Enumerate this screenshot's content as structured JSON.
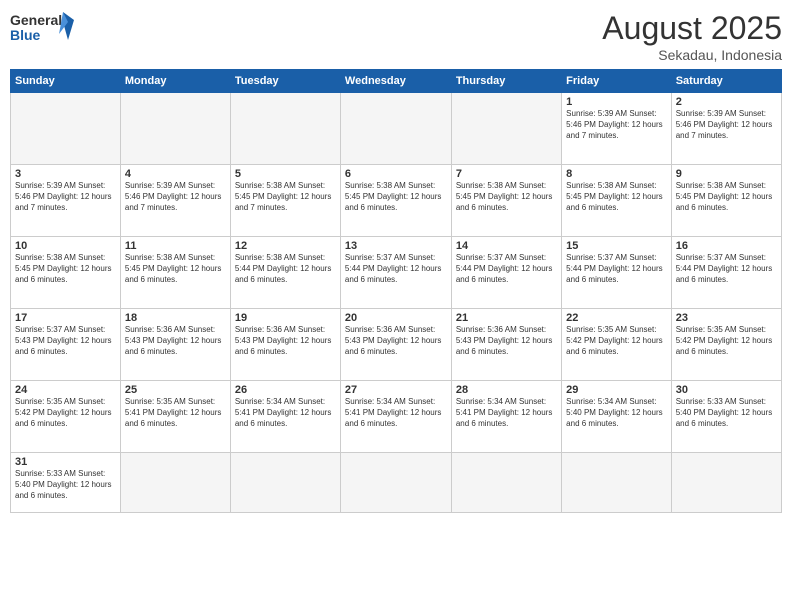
{
  "header": {
    "logo_general": "General",
    "logo_blue": "Blue",
    "month_year": "August 2025",
    "location": "Sekadau, Indonesia"
  },
  "weekdays": [
    "Sunday",
    "Monday",
    "Tuesday",
    "Wednesday",
    "Thursday",
    "Friday",
    "Saturday"
  ],
  "weeks": [
    [
      {
        "day": "",
        "info": ""
      },
      {
        "day": "",
        "info": ""
      },
      {
        "day": "",
        "info": ""
      },
      {
        "day": "",
        "info": ""
      },
      {
        "day": "",
        "info": ""
      },
      {
        "day": "1",
        "info": "Sunrise: 5:39 AM\nSunset: 5:46 PM\nDaylight: 12 hours and 7 minutes."
      },
      {
        "day": "2",
        "info": "Sunrise: 5:39 AM\nSunset: 5:46 PM\nDaylight: 12 hours and 7 minutes."
      }
    ],
    [
      {
        "day": "3",
        "info": "Sunrise: 5:39 AM\nSunset: 5:46 PM\nDaylight: 12 hours and 7 minutes."
      },
      {
        "day": "4",
        "info": "Sunrise: 5:39 AM\nSunset: 5:46 PM\nDaylight: 12 hours and 7 minutes."
      },
      {
        "day": "5",
        "info": "Sunrise: 5:38 AM\nSunset: 5:45 PM\nDaylight: 12 hours and 7 minutes."
      },
      {
        "day": "6",
        "info": "Sunrise: 5:38 AM\nSunset: 5:45 PM\nDaylight: 12 hours and 6 minutes."
      },
      {
        "day": "7",
        "info": "Sunrise: 5:38 AM\nSunset: 5:45 PM\nDaylight: 12 hours and 6 minutes."
      },
      {
        "day": "8",
        "info": "Sunrise: 5:38 AM\nSunset: 5:45 PM\nDaylight: 12 hours and 6 minutes."
      },
      {
        "day": "9",
        "info": "Sunrise: 5:38 AM\nSunset: 5:45 PM\nDaylight: 12 hours and 6 minutes."
      }
    ],
    [
      {
        "day": "10",
        "info": "Sunrise: 5:38 AM\nSunset: 5:45 PM\nDaylight: 12 hours and 6 minutes."
      },
      {
        "day": "11",
        "info": "Sunrise: 5:38 AM\nSunset: 5:45 PM\nDaylight: 12 hours and 6 minutes."
      },
      {
        "day": "12",
        "info": "Sunrise: 5:38 AM\nSunset: 5:44 PM\nDaylight: 12 hours and 6 minutes."
      },
      {
        "day": "13",
        "info": "Sunrise: 5:37 AM\nSunset: 5:44 PM\nDaylight: 12 hours and 6 minutes."
      },
      {
        "day": "14",
        "info": "Sunrise: 5:37 AM\nSunset: 5:44 PM\nDaylight: 12 hours and 6 minutes."
      },
      {
        "day": "15",
        "info": "Sunrise: 5:37 AM\nSunset: 5:44 PM\nDaylight: 12 hours and 6 minutes."
      },
      {
        "day": "16",
        "info": "Sunrise: 5:37 AM\nSunset: 5:44 PM\nDaylight: 12 hours and 6 minutes."
      }
    ],
    [
      {
        "day": "17",
        "info": "Sunrise: 5:37 AM\nSunset: 5:43 PM\nDaylight: 12 hours and 6 minutes."
      },
      {
        "day": "18",
        "info": "Sunrise: 5:36 AM\nSunset: 5:43 PM\nDaylight: 12 hours and 6 minutes."
      },
      {
        "day": "19",
        "info": "Sunrise: 5:36 AM\nSunset: 5:43 PM\nDaylight: 12 hours and 6 minutes."
      },
      {
        "day": "20",
        "info": "Sunrise: 5:36 AM\nSunset: 5:43 PM\nDaylight: 12 hours and 6 minutes."
      },
      {
        "day": "21",
        "info": "Sunrise: 5:36 AM\nSunset: 5:43 PM\nDaylight: 12 hours and 6 minutes."
      },
      {
        "day": "22",
        "info": "Sunrise: 5:35 AM\nSunset: 5:42 PM\nDaylight: 12 hours and 6 minutes."
      },
      {
        "day": "23",
        "info": "Sunrise: 5:35 AM\nSunset: 5:42 PM\nDaylight: 12 hours and 6 minutes."
      }
    ],
    [
      {
        "day": "24",
        "info": "Sunrise: 5:35 AM\nSunset: 5:42 PM\nDaylight: 12 hours and 6 minutes."
      },
      {
        "day": "25",
        "info": "Sunrise: 5:35 AM\nSunset: 5:41 PM\nDaylight: 12 hours and 6 minutes."
      },
      {
        "day": "26",
        "info": "Sunrise: 5:34 AM\nSunset: 5:41 PM\nDaylight: 12 hours and 6 minutes."
      },
      {
        "day": "27",
        "info": "Sunrise: 5:34 AM\nSunset: 5:41 PM\nDaylight: 12 hours and 6 minutes."
      },
      {
        "day": "28",
        "info": "Sunrise: 5:34 AM\nSunset: 5:41 PM\nDaylight: 12 hours and 6 minutes."
      },
      {
        "day": "29",
        "info": "Sunrise: 5:34 AM\nSunset: 5:40 PM\nDaylight: 12 hours and 6 minutes."
      },
      {
        "day": "30",
        "info": "Sunrise: 5:33 AM\nSunset: 5:40 PM\nDaylight: 12 hours and 6 minutes."
      }
    ],
    [
      {
        "day": "31",
        "info": "Sunrise: 5:33 AM\nSunset: 5:40 PM\nDaylight: 12 hours and 6 minutes."
      },
      {
        "day": "",
        "info": ""
      },
      {
        "day": "",
        "info": ""
      },
      {
        "day": "",
        "info": ""
      },
      {
        "day": "",
        "info": ""
      },
      {
        "day": "",
        "info": ""
      },
      {
        "day": "",
        "info": ""
      }
    ]
  ]
}
